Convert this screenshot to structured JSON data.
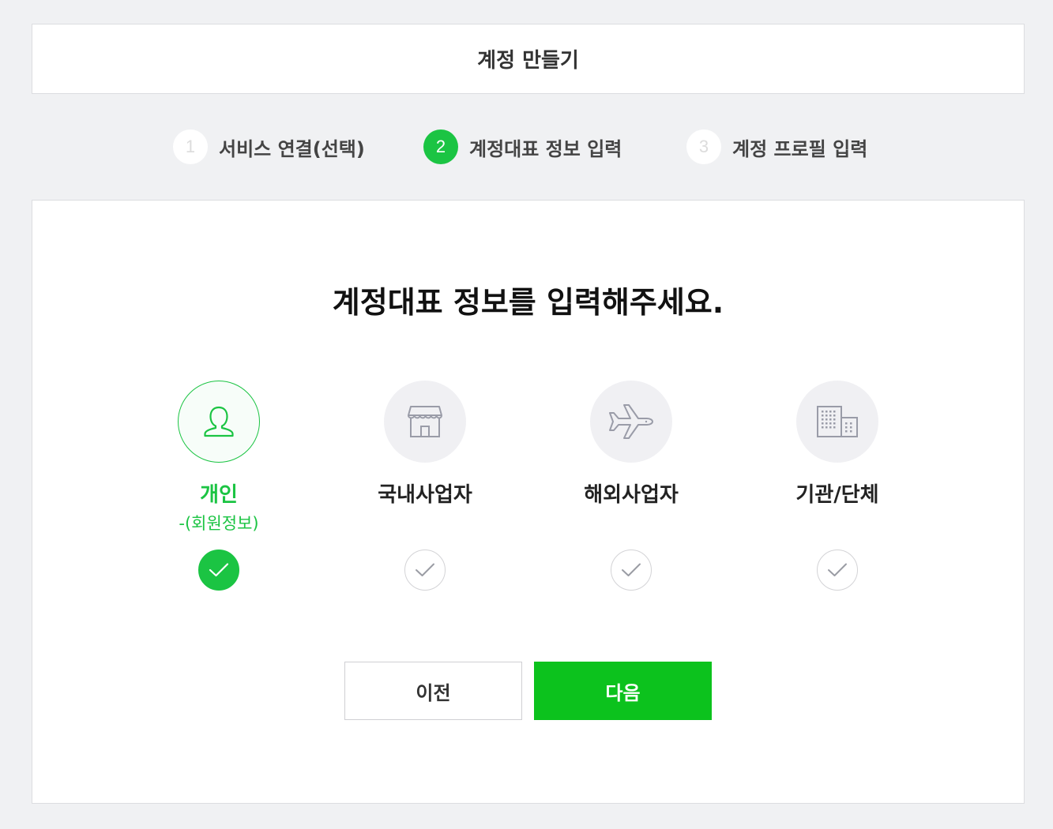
{
  "header": {
    "title": "계정 만들기"
  },
  "steps": [
    {
      "num": "1",
      "label": "서비스 연결(선택)",
      "active": false
    },
    {
      "num": "2",
      "label": "계정대표 정보 입력",
      "active": true
    },
    {
      "num": "3",
      "label": "계정 프로필 입력",
      "active": false
    }
  ],
  "main": {
    "title": "계정대표 정보를 입력해주세요.",
    "options": [
      {
        "name": "개인",
        "sub": "-(회원정보)",
        "icon": "person-icon",
        "selected": true
      },
      {
        "name": "국내사업자",
        "sub": "",
        "icon": "store-icon",
        "selected": false
      },
      {
        "name": "해외사업자",
        "sub": "",
        "icon": "airplane-icon",
        "selected": false
      },
      {
        "name": "기관/단체",
        "sub": "",
        "icon": "building-icon",
        "selected": false
      }
    ],
    "buttons": {
      "prev": "이전",
      "next": "다음"
    }
  },
  "colors": {
    "accent": "#1bc443",
    "next_button": "#0cc21d",
    "background": "#f0f1f3"
  }
}
